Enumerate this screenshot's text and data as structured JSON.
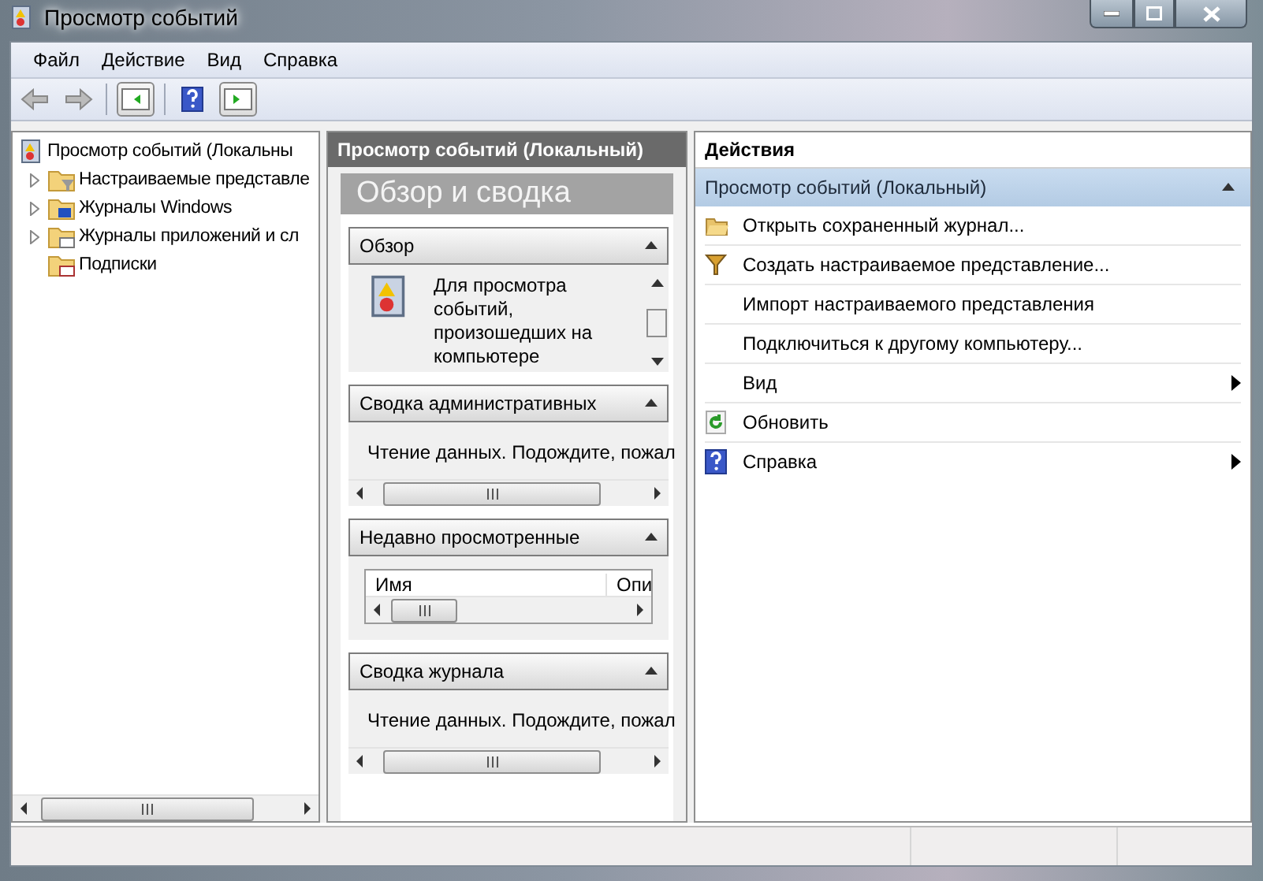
{
  "window": {
    "title": "Просмотр событий"
  },
  "menu": [
    "Файл",
    "Действие",
    "Вид",
    "Справка"
  ],
  "tree": {
    "root": "Просмотр событий (Локальны",
    "items": [
      {
        "label": "Настраиваемые представле",
        "kind": "filter",
        "expanded": false
      },
      {
        "label": "Журналы Windows",
        "kind": "windows",
        "expanded": false
      },
      {
        "label": "Журналы приложений и сл",
        "kind": "apps",
        "expanded": false
      },
      {
        "label": "Подписки",
        "kind": "subs"
      }
    ]
  },
  "center": {
    "header": "Просмотр событий (Локальный)",
    "title": "Обзор и сводка",
    "sections": [
      {
        "kind": "overview",
        "title": "Обзор",
        "text": [
          "Для просмотра",
          "событий,",
          "произошедших на",
          "компьютере"
        ]
      },
      {
        "kind": "reading",
        "title": "Сводка административных",
        "text": "Чтение данных. Подождите, пожал"
      },
      {
        "kind": "table",
        "title": "Недавно просмотренные",
        "columns": [
          "Имя",
          "Опи"
        ]
      },
      {
        "kind": "reading",
        "title": "Сводка журнала",
        "text": "Чтение данных. Подождите, пожал"
      }
    ]
  },
  "actions": {
    "header": "Действия",
    "group": "Просмотр событий (Локальный)",
    "items": [
      {
        "label": "Открыть сохраненный журнал...",
        "kind": "folder"
      },
      {
        "label": "Создать настраиваемое представление...",
        "kind": "filter"
      },
      {
        "label": "Импорт настраиваемого представления",
        "kind": "plain"
      },
      {
        "label": "Подключиться к другому компьютеру...",
        "kind": "plain"
      },
      {
        "label": "Вид",
        "kind": "plain",
        "submenu": true
      },
      {
        "label": "Обновить",
        "kind": "refresh"
      },
      {
        "label": "Справка",
        "kind": "help",
        "submenu": true
      }
    ]
  }
}
